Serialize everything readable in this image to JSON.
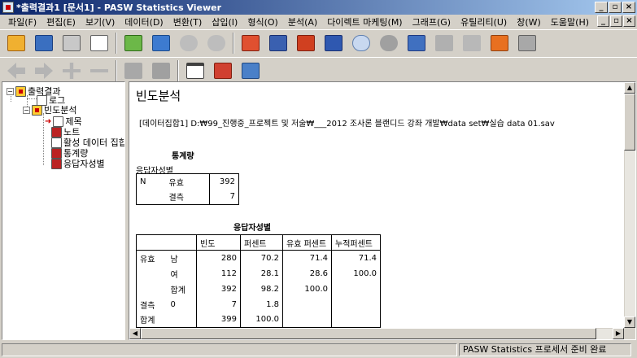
{
  "window": {
    "title": "*출력결과1 [문서1] - PASW Statistics Viewer",
    "controls": [
      "_",
      "▫",
      "×"
    ]
  },
  "menu": {
    "items": [
      "파일(F)",
      "편집(E)",
      "보기(V)",
      "데이터(D)",
      "변환(T)",
      "삽입(I)",
      "형식(O)",
      "분석(A)",
      "다이렉트 마케팅(M)",
      "그래프(G)",
      "유틸리티(U)",
      "창(W)",
      "도움말(H)"
    ],
    "doc_controls": [
      "_",
      "▫",
      "×"
    ]
  },
  "toolbar1": {
    "icons": [
      "open-icon",
      "save-icon",
      "print-icon",
      "print-preview-icon",
      "export-icon",
      "recall-dialog-icon",
      "undo-icon",
      "redo-icon",
      "goto-data-icon",
      "goto-case-icon",
      "goto-variable-icon",
      "variables-icon",
      "show-all-icon",
      "hide-icon",
      "split-file-icon",
      "weight-icon",
      "select-cases-icon",
      "value-labels-icon",
      "designate-window-icon"
    ]
  },
  "toolbar2": {
    "icons": [
      "promote-icon",
      "demote-icon",
      "expand-icon",
      "collapse-icon",
      "show-icon",
      "hide-item-icon",
      "insert-heading-icon",
      "insert-title-icon",
      "insert-text-icon"
    ]
  },
  "outline": {
    "root": "출력결과",
    "log": "로그",
    "frequencies": "빈도분석",
    "children": [
      "제목",
      "노트",
      "활성 데이터 집합",
      "통계량",
      "응답자성별"
    ]
  },
  "content": {
    "heading": "빈도분석",
    "dataset_line": "[데이터집합1] D:₩99_진행중_프로젝트 및 저술₩___2012 조사론 블랜디드 강좌 개발₩data set₩실습 data 01.sav",
    "stats": {
      "title": "통계량",
      "subtitle": "응답자성별",
      "rows": [
        {
          "label": "N",
          "sub": "유효",
          "value": "392"
        },
        {
          "label": "",
          "sub": "결측",
          "value": "7"
        }
      ]
    },
    "freq": {
      "title": "응답자성별",
      "headers": [
        "빈도",
        "퍼센트",
        "유효 퍼센트",
        "누적퍼센트"
      ],
      "rows": [
        {
          "c1": "유효",
          "c2": "남",
          "v1": "280",
          "v2": "70.2",
          "v3": "71.4",
          "v4": "71.4"
        },
        {
          "c1": "",
          "c2": "여",
          "v1": "112",
          "v2": "28.1",
          "v3": "28.6",
          "v4": "100.0"
        },
        {
          "c1": "",
          "c2": "합계",
          "v1": "392",
          "v2": "98.2",
          "v3": "100.0",
          "v4": ""
        },
        {
          "c1": "결측",
          "c2": "0",
          "v1": "7",
          "v2": "1.8",
          "v3": "",
          "v4": ""
        },
        {
          "c1": "합계",
          "c2": "",
          "v1": "399",
          "v2": "100.0",
          "v3": "",
          "v4": ""
        }
      ]
    }
  },
  "status": {
    "text": "PASW Statistics 프로세서 준비 완료"
  }
}
